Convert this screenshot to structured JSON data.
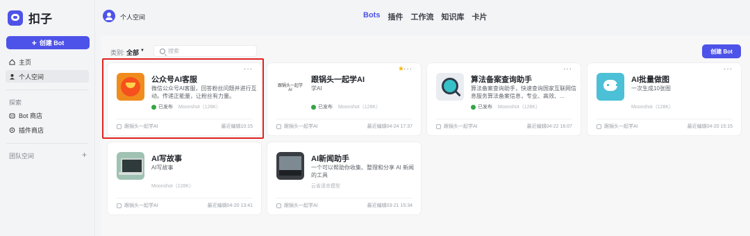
{
  "brand": {
    "name": "扣子"
  },
  "sidebar": {
    "create_bot_label": "创建 Bot",
    "items": [
      {
        "label": "主页"
      },
      {
        "label": "个人空间"
      }
    ],
    "explore_section": "探索",
    "explore_items": [
      {
        "label": "Bot 商店"
      },
      {
        "label": "插件商店"
      }
    ],
    "team_section": "团队空间",
    "team_add": "+"
  },
  "header": {
    "workspace": "个人空间",
    "tabs": [
      "Bots",
      "插件",
      "工作流",
      "知识库",
      "卡片"
    ],
    "active_tab": "Bots"
  },
  "toolbar": {
    "filter_label": "类别:",
    "filter_value": "全部",
    "search_placeholder": "搜索",
    "create_bot_label": "创建 Bot"
  },
  "cards": [
    {
      "title": "公众号AI客服",
      "desc": "微信公众号AI客服，回答粉丝问题并进行互动。传递正能量，让粉丝有力量。",
      "published": "已发布",
      "model": "Moonshot（128K）",
      "author": "跟锅头一起学AI",
      "edited": "最近编辑10:15"
    },
    {
      "title": "跟锅头一起学AI",
      "desc": "学AI",
      "published": "已发布",
      "model": "Moonshot（128K）",
      "author": "跟锅头一起学AI",
      "edited": "最近编辑04-24 17:37",
      "starred": true,
      "avatar_text": "跟锅头一起学AI"
    },
    {
      "title": "算法备案查询助手",
      "desc": "算法备案查询助手，快速查询国家互联网信息服务算法备案信息，专业、高效、...",
      "published": "已发布",
      "model": "Moonshot（128K）",
      "author": "跟锅头一起学AI",
      "edited": "最近编辑04-22 16:07"
    },
    {
      "title": "AI批量做图",
      "desc": "一次生成10张图",
      "published": "",
      "model": "Moonshot（128K）",
      "author": "跟锅头一起学AI",
      "edited": "最近编辑04-20 15:15"
    },
    {
      "title": "AI写故事",
      "desc": "AI写故事",
      "published": "",
      "model": "Moonshot（128K）",
      "author": "跟锅头一起学AI",
      "edited": "最近编辑04-20 13:41"
    },
    {
      "title": "AI新闻助手",
      "desc": "一个可以帮助你收集、整理和分享 AI 新闻的工具",
      "published": "",
      "model": "云雀语言模型",
      "author": "跟锅头一起学AI",
      "edited": "最近编辑03-21 15:34"
    }
  ],
  "colors": {
    "accent": "#4d53e8",
    "highlight": "#e02020",
    "published": "#32a645",
    "star": "#f5b90a"
  }
}
